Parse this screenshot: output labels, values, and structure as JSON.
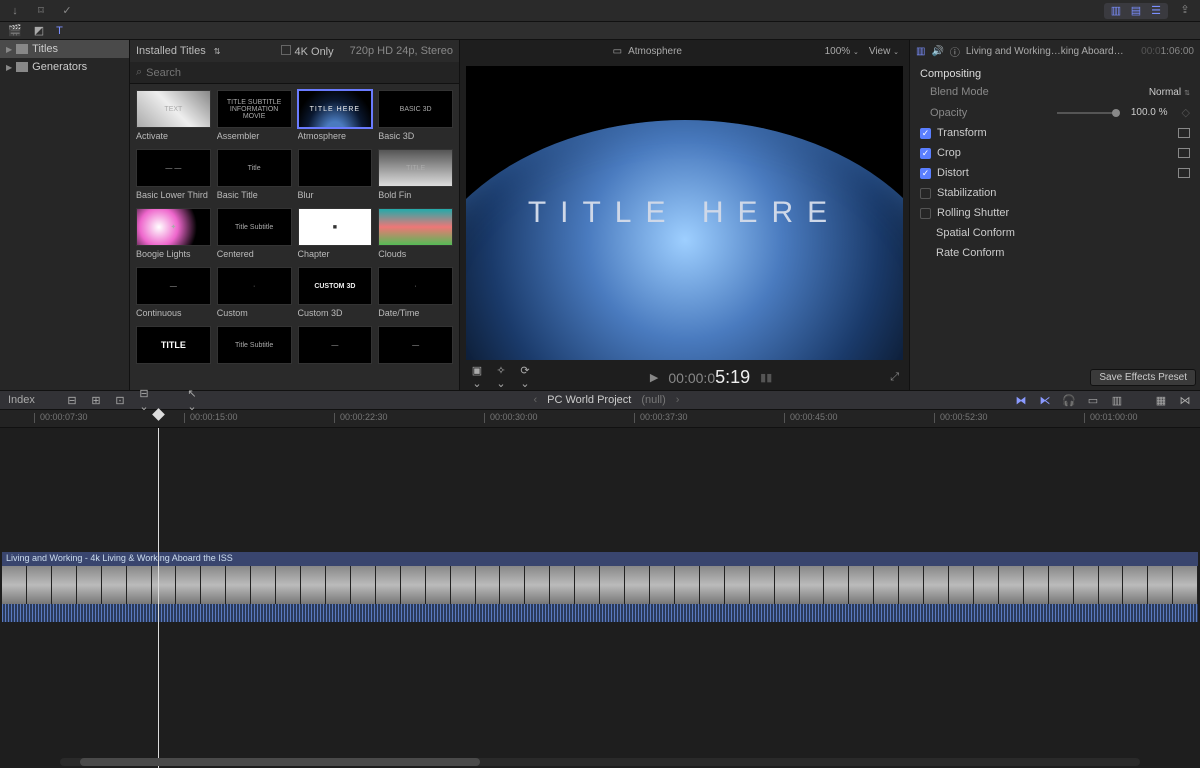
{
  "toolbar": {},
  "browser": {
    "header": "Installed Titles",
    "fourk_label": "4K Only",
    "format": "720p HD 24p, Stereo",
    "search_placeholder": "Search",
    "sidebar": {
      "items": [
        "Titles",
        "Generators"
      ],
      "selected": 0
    },
    "titles": [
      {
        "label": "Activate",
        "cls": "activate",
        "txt": "TEXT"
      },
      {
        "label": "Assembler",
        "txt": "TITLE SUBTITLE\nINFORMATION MOVIE"
      },
      {
        "label": "Atmosphere",
        "cls": "atmo",
        "txt": "TITLE HERE",
        "selected": true
      },
      {
        "label": "Basic 3D",
        "txt": "BASIC 3D"
      },
      {
        "label": "Basic Lower Third",
        "txt": "— —"
      },
      {
        "label": "Basic Title",
        "txt": "Title"
      },
      {
        "label": "Blur",
        "txt": ""
      },
      {
        "label": "Bold Fin",
        "cls": "boldfin",
        "txt": "TITLE"
      },
      {
        "label": "Boogie Lights",
        "cls": "boogie",
        "txt": "✦"
      },
      {
        "label": "Centered",
        "txt": "Title\nSubtitle"
      },
      {
        "label": "Chapter",
        "cls": "chapter",
        "txt": "■"
      },
      {
        "label": "Clouds",
        "cls": "clouds",
        "txt": ""
      },
      {
        "label": "Continuous",
        "txt": "—"
      },
      {
        "label": "Custom",
        "txt": "·"
      },
      {
        "label": "Custom 3D",
        "cls": "cust3d",
        "txt": "CUSTOM 3D"
      },
      {
        "label": "Date/Time",
        "txt": "·"
      },
      {
        "label": "",
        "cls": "titlebold",
        "txt": "TITLE"
      },
      {
        "label": "",
        "txt": "Title\nSubtitle"
      },
      {
        "label": "",
        "txt": "—"
      },
      {
        "label": "",
        "txt": "—"
      }
    ]
  },
  "viewer": {
    "clip_name": "Atmosphere",
    "zoom": "100%",
    "view_label": "View",
    "title_overlay": "TITLE HERE",
    "timecode_prefix": "00:00:0",
    "timecode_big": "5:19"
  },
  "inspector": {
    "clip_title": "Living and Working…king Aboard the ISS",
    "duration": "1:06:00",
    "duration_prefix": "00:0",
    "compositing": "Compositing",
    "blend_label": "Blend Mode",
    "blend_value": "Normal",
    "opacity_label": "Opacity",
    "opacity_value": "100.0 %",
    "rows": [
      {
        "label": "Transform",
        "checked": true,
        "icon": true
      },
      {
        "label": "Crop",
        "checked": true,
        "icon": true
      },
      {
        "label": "Distort",
        "checked": true,
        "icon": true
      },
      {
        "label": "Stabilization",
        "checked": false
      },
      {
        "label": "Rolling Shutter",
        "checked": false
      }
    ],
    "extra": [
      "Spatial Conform",
      "Rate Conform"
    ],
    "preset_btn": "Save Effects Preset"
  },
  "midbar": {
    "index": "Index",
    "project": "PC World Project",
    "null": "(null)"
  },
  "ruler": [
    "00:00:07:30",
    "00:00:15:00",
    "00:00:22:30",
    "00:00:30:00",
    "00:00:37:30",
    "00:00:45:00",
    "00:00:52:30",
    "00:01:00:00"
  ],
  "timeline": {
    "clip_title": "Living and Working - 4k Living & Working Aboard the ISS",
    "playhead_pct": 13.2
  }
}
